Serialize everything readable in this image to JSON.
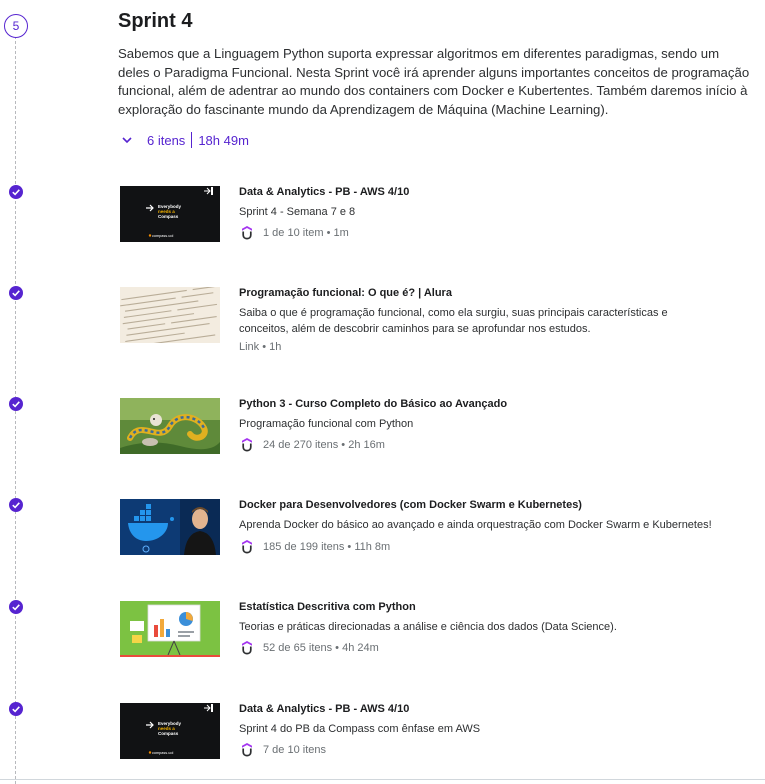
{
  "section": {
    "number": "5",
    "title": "Sprint 4",
    "description": "Sabemos que a Linguagem Python suporta expressar algoritmos em diferentes paradigmas, sendo um deles o Paradigma Funcional. Nesta Sprint você irá aprender alguns importantes conceitos de programação funcional, além de adentrar ao mundo dos containers com Docker e Kubertentes. Também daremos início à exploração do fascinante mundo da Aprendizagem de Máquina (Machine Learning).",
    "items_count": "6 itens",
    "duration": "18h 49m"
  },
  "items": [
    {
      "title": "Data & Analytics - PB - AWS 4/10",
      "subtitle": "Sprint 4 - Semana 7 e 8",
      "meta": "1 de 10 item",
      "duration": "1m",
      "has_icon": true,
      "thumb": {
        "line1": "Everybody",
        "line2": "needs a",
        "line3": "Compass",
        "brand": "compass.uol"
      }
    },
    {
      "title": "Programação funcional: O que é? | Alura",
      "subtitle": "Saiba o que é programação funcional, como ela surgiu, suas principais características e conceitos, além de descobrir caminhos para se aprofundar nos estudos.",
      "meta": "Link",
      "duration": "1h",
      "has_icon": false
    },
    {
      "title": "Python 3 - Curso Completo do Básico ao Avançado",
      "subtitle": "Programação funcional com Python",
      "meta": "24 de 270 itens",
      "duration": "2h 16m",
      "has_icon": true
    },
    {
      "title": "Docker para Desenvolvedores (com Docker Swarm e Kubernetes)",
      "subtitle": "Aprenda Docker do básico ao avançado e ainda orquestração com Docker Swarm e Kubernetes!",
      "meta": "185 de 199 itens",
      "duration": "11h 8m",
      "has_icon": true
    },
    {
      "title": "Estatística Descritiva com Python",
      "subtitle": "Teorias e práticas direcionadas a análise e ciência dos dados (Data Science).",
      "meta": "52 de 65 itens",
      "duration": "4h 24m",
      "has_icon": true
    },
    {
      "title": "Data & Analytics - PB - AWS 4/10",
      "subtitle": "Sprint 4 do PB da Compass com ênfase em AWS",
      "meta": "7 de 10 itens",
      "duration": "",
      "has_icon": true,
      "thumb": {
        "line1": "Everybody",
        "line2": "needs a",
        "line3": "Compass",
        "brand": "compass.uol"
      }
    }
  ],
  "colors": {
    "accent": "#5624d0",
    "text": "#1c1d1f",
    "muted": "#6a6f73"
  }
}
